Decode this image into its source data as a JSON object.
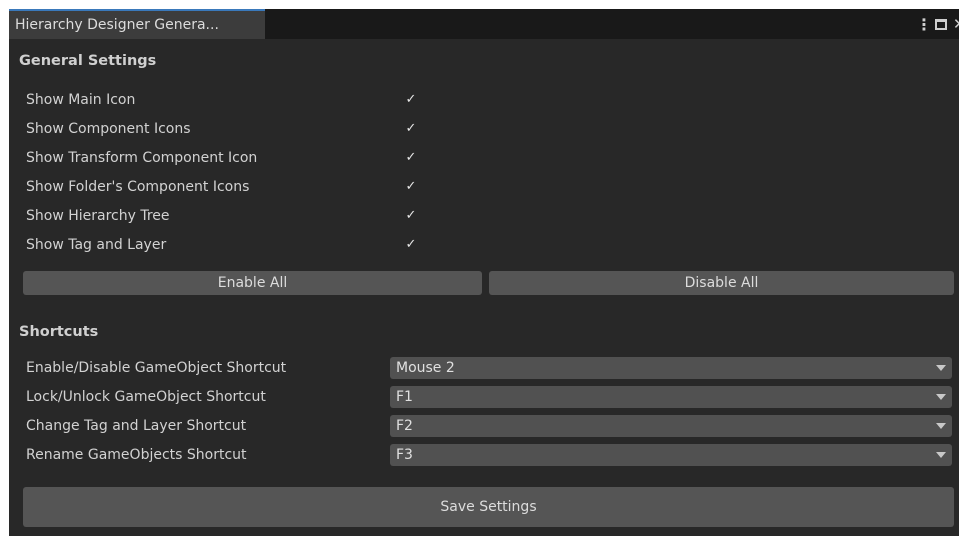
{
  "window": {
    "tab_title": "Hierarchy Designer Genera...",
    "icons": [
      "kebab-menu-icon",
      "maximize-icon",
      "close-icon"
    ]
  },
  "general": {
    "title": "General Settings",
    "options": [
      {
        "label": "Show Main Icon",
        "checked": true
      },
      {
        "label": "Show Component Icons",
        "checked": true
      },
      {
        "label": "Show Transform Component Icon",
        "checked": true
      },
      {
        "label": "Show Folder's Component Icons",
        "checked": true
      },
      {
        "label": "Show Hierarchy Tree",
        "checked": true
      },
      {
        "label": "Show Tag and Layer",
        "checked": true
      }
    ],
    "enable_all": "Enable All",
    "disable_all": "Disable All"
  },
  "shortcuts": {
    "title": "Shortcuts",
    "items": [
      {
        "label": "Enable/Disable GameObject Shortcut",
        "value": "Mouse 2"
      },
      {
        "label": "Lock/Unlock GameObject Shortcut",
        "value": "F1"
      },
      {
        "label": "Change Tag and Layer Shortcut",
        "value": "F2"
      },
      {
        "label": "Rename GameObjects Shortcut",
        "value": "F3"
      }
    ]
  },
  "save_label": "Save Settings",
  "check_glyph": "✓",
  "colors": {
    "background": "#282828",
    "tab_accent": "#3a79bb",
    "button": "#555555"
  }
}
